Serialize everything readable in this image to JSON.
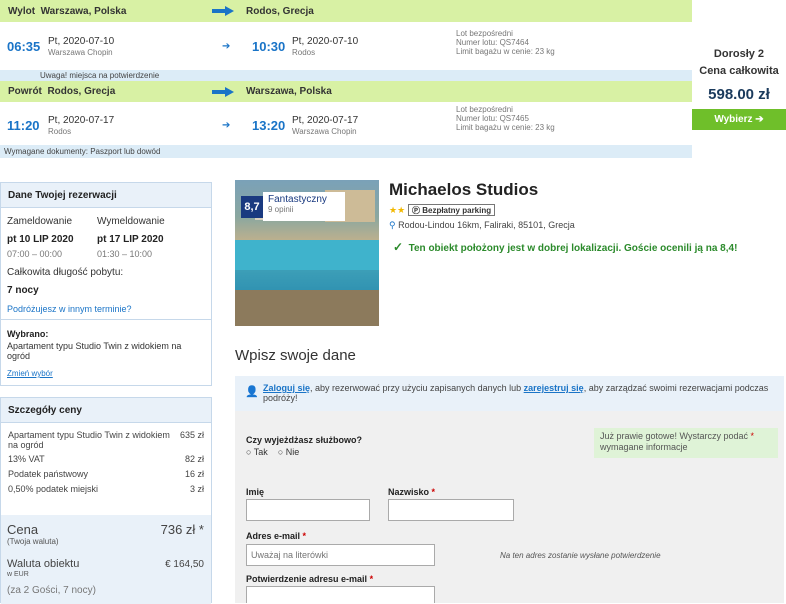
{
  "outbound": {
    "bar_label": "Wylot",
    "from": "Warszawa, Polska",
    "to": "Rodos, Grecja",
    "dep_time": "06:35",
    "dep_date": "Pt, 2020-07-10",
    "dep_airport": "Warszawa Chopin",
    "arr_time": "10:30",
    "arr_date": "Pt, 2020-07-10",
    "arr_airport": "Rodos",
    "info1": "Lot bezpośredni",
    "info2": "Numer lotu: QS7464",
    "info3": "Limit bagażu w cenie: 23 kg",
    "note": "Uwaga! miejsca na potwierdzenie"
  },
  "return": {
    "bar_label": "Powrót",
    "from": "Rodos, Grecja",
    "to": "Warszawa, Polska",
    "dep_time": "11:20",
    "dep_date": "Pt, 2020-07-17",
    "dep_airport": "Rodos",
    "arr_time": "13:20",
    "arr_date": "Pt, 2020-07-17",
    "arr_airport": "Warszawa Chopin",
    "info1": "Lot bezpośredni",
    "info2": "Numer lotu: QS7465",
    "info3": "Limit bagażu w cenie: 23 kg",
    "note": "Wymagane dokumenty: Paszport lub dowód"
  },
  "price_box": {
    "line1": "Dorosły 2",
    "line2": "Cena całkowita",
    "price": "598.00 zł",
    "button": "Wybierz"
  },
  "reservation": {
    "title": "Dane Twojej rezerwacji",
    "checkin_label": "Zameldowanie",
    "checkout_label": "Wymeldowanie",
    "checkin_date": "pt 10 LIP 2020",
    "checkout_date": "pt 17 LIP 2020",
    "checkin_time": "07:00 – 00:00",
    "checkout_time": "01:30 – 10:00",
    "duration_label": "Całkowita długość pobytu:",
    "duration": "7 nocy",
    "change_link": "Podróżujesz w innym terminie?",
    "chosen_label": "Wybrano:",
    "chosen": "Apartament typu Studio Twin z widokiem na ogród",
    "change_choice": "Zmień wybór"
  },
  "price_details": {
    "title": "Szczegóły ceny",
    "rows": [
      {
        "label": "Apartament typu Studio Twin z widokiem na ogród",
        "value": "635 zł"
      },
      {
        "label": "13% VAT",
        "value": "82 zł"
      },
      {
        "label": "Podatek państwowy",
        "value": "16 zł"
      },
      {
        "label": "0,50% podatek miejski",
        "value": "3 zł"
      }
    ],
    "total_label": "Cena",
    "total_sub": "(Twoja waluta)",
    "total_value": "736 zł *",
    "hotel_cur_label": "Waluta obiektu",
    "hotel_cur_sub": "w EUR",
    "hotel_cur_value": "€ 164,50",
    "guests": "(za 2 Gości, 7 nocy)"
  },
  "hotel": {
    "score": "8,7",
    "score_word": "Fantastyczny",
    "reviews": "9 opinii",
    "name": "Michaelos Studios",
    "stars": "★★",
    "parking": "Ⓟ Bezpłatny parking",
    "address": "Rodou-Lindou 16km, Faliraki, 85101, Grecja",
    "location_note": "Ten obiekt położony jest w dobrej lokalizacji. Goście ocenili ją na 8,4!"
  },
  "form": {
    "heading": "Wpisz swoje dane",
    "login_link": "Zaloguj się",
    "login_mid": ", aby rezerwować przy użyciu zapisanych danych lub",
    "register_link": "zarejestruj się",
    "login_end": ", aby zarządzać swoimi rezerwacjami podczas podróży!",
    "business_q": "Czy wyjeżdżasz służbowo?",
    "yes": "Tak",
    "no": "Nie",
    "ready_note": "Już prawie gotowe! Wystarczy podać",
    "ready_note2": "wymagane informacje",
    "first_name": "Imię",
    "last_name": "Nazwisko",
    "email_label": "Adres e-mail",
    "email_placeholder": "Uważaj na literówki",
    "email_note": "Na ten adres zostanie wysłane potwierdzenie",
    "email_confirm": "Potwierdzenie adresu e-mail"
  },
  "colors": {
    "accent": "#1a74c7",
    "green": "#6fbf2a",
    "bar": "#d8f1a4"
  }
}
